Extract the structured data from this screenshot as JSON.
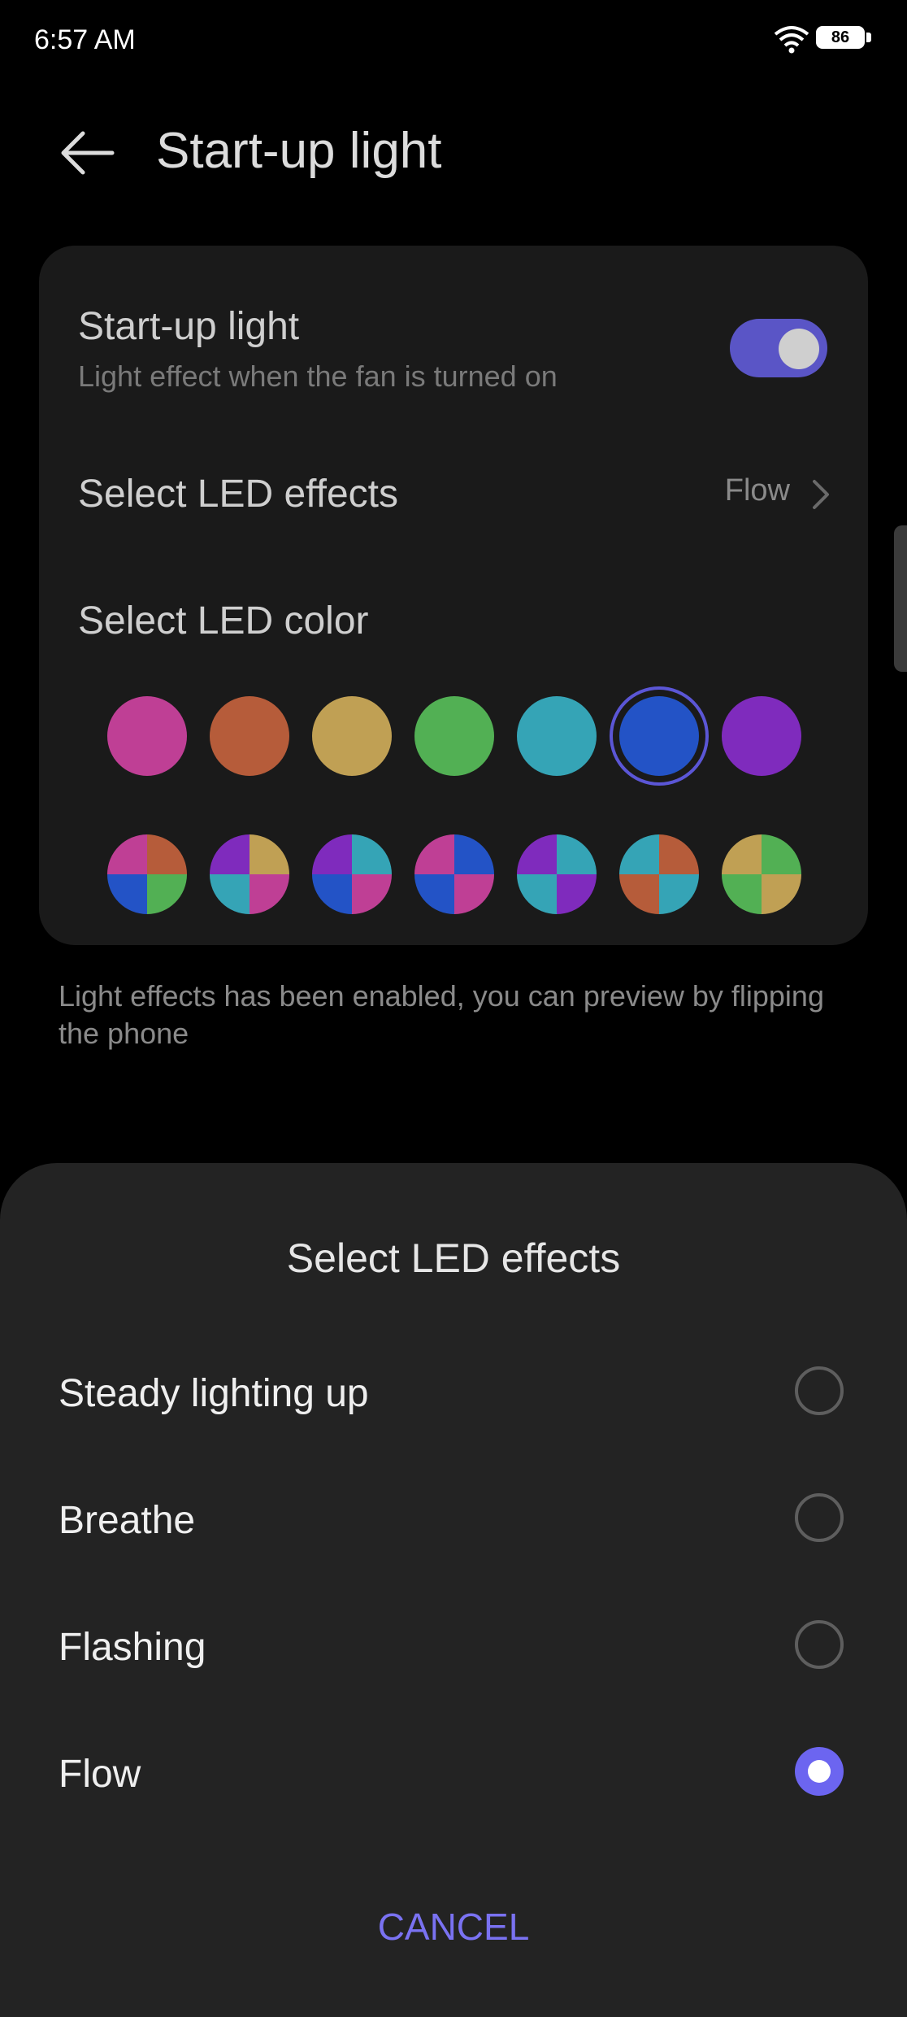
{
  "status_bar": {
    "time": "6:57 AM",
    "battery": "86"
  },
  "header": {
    "title": "Start-up light"
  },
  "settings": {
    "startup_title": "Start-up light",
    "startup_subtitle": "Light effect when the fan is turned on",
    "startup_enabled": true,
    "led_effects_label": "Select LED effects",
    "led_effects_value": "Flow",
    "led_color_label": "Select LED color",
    "solid_colors": [
      "#bf3f95",
      "#b65c3a",
      "#c0a054",
      "#52b054",
      "#35a4b6",
      "#2353c6",
      "#7f2bbd"
    ],
    "selected_color": "#2353c6",
    "multi_colors": [
      [
        "#bf3f95",
        "#b65c3a",
        "#2353c6",
        "#52b054"
      ],
      [
        "#7f2bbd",
        "#c0a054",
        "#35a4b6",
        "#bf3f95"
      ],
      [
        "#7f2bbd",
        "#35a4b6",
        "#2353c6",
        "#bf3f95"
      ],
      [
        "#bf3f95",
        "#2353c6",
        "#2353c6",
        "#bf3f95"
      ],
      [
        "#7f2bbd",
        "#35a4b6",
        "#35a4b6",
        "#7f2bbd"
      ],
      [
        "#35a4b6",
        "#b65c3a",
        "#b65c3a",
        "#35a4b6"
      ],
      [
        "#c0a054",
        "#52b054",
        "#52b054",
        "#c0a054"
      ]
    ]
  },
  "hint": "Light effects has been enabled, you can preview by flipping the phone",
  "sheet": {
    "title": "Select LED effects",
    "options": [
      {
        "label": "Steady lighting up",
        "checked": false
      },
      {
        "label": "Breathe",
        "checked": false
      },
      {
        "label": "Flashing",
        "checked": false
      },
      {
        "label": "Flow",
        "checked": true
      }
    ],
    "cancel": "CANCEL"
  },
  "colors": {
    "accent": "#6c65f0",
    "toggle_on": "#5a55c6",
    "card": "#1a1a1a",
    "sheet": "#232323"
  }
}
